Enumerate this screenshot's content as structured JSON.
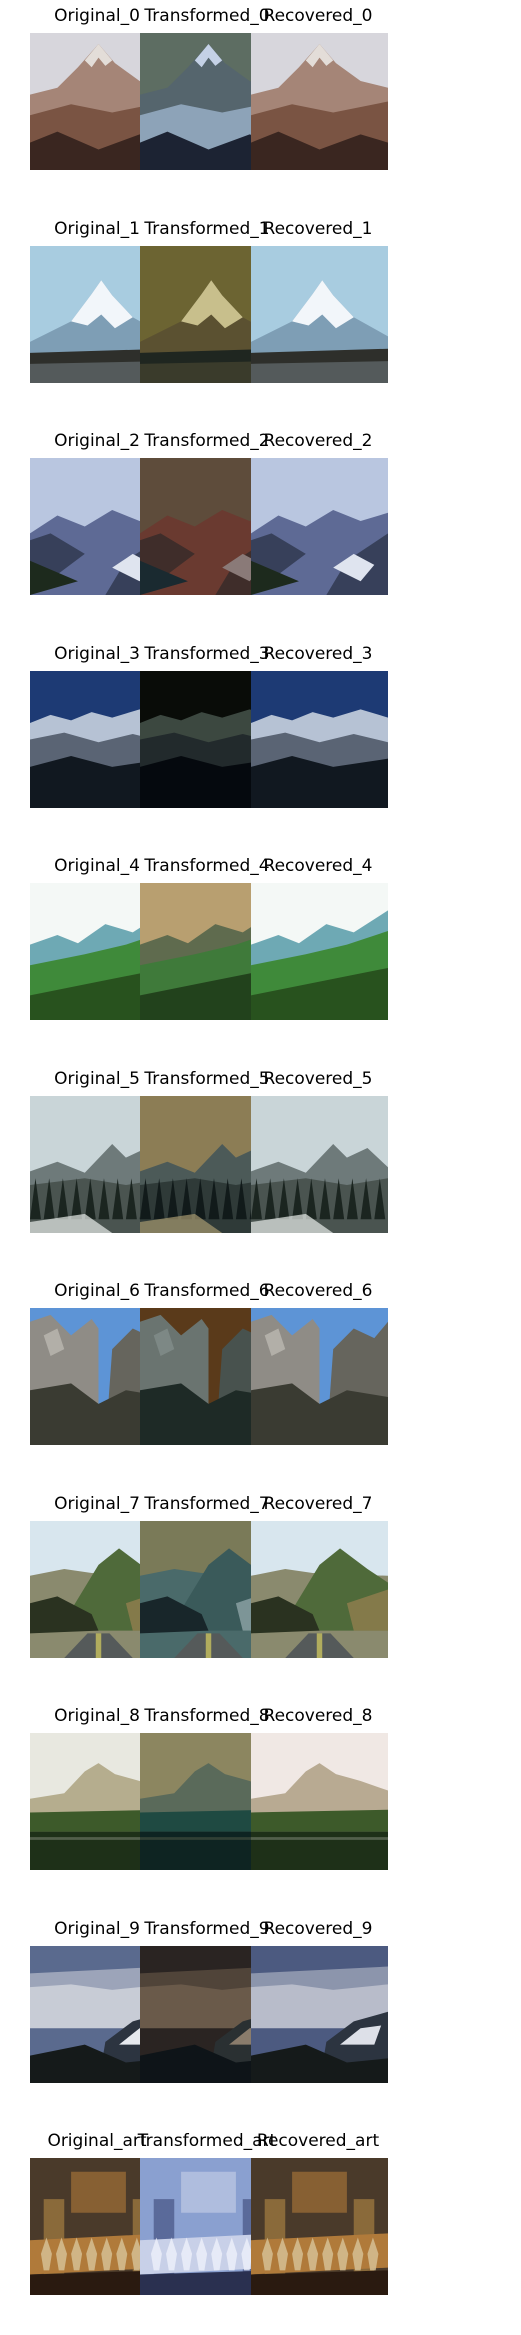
{
  "rows": [
    {
      "captions": [
        "Original_0",
        "Transformed_0",
        "Recovered_0"
      ],
      "scene": "peak",
      "palettes": [
        {
          "sky": "#d7d6dc",
          "far": "#a58577",
          "mid": "#7a5443",
          "near": "#3a2620",
          "snow": "#e3ddd8"
        },
        {
          "sky": "#5d6d62",
          "far": "#55656d",
          "mid": "#8da3b8",
          "near": "#1c2333",
          "snow": "#c4d1e6"
        },
        {
          "sky": "#d7d6dc",
          "far": "#a58577",
          "mid": "#7a5443",
          "near": "#3a2620",
          "snow": "#e3ddd8"
        }
      ]
    },
    {
      "captions": [
        "Original_1",
        "Transformed_1",
        "Recovered_1"
      ],
      "scene": "snowpeak",
      "palettes": [
        {
          "sky": "#a8cce0",
          "far": "#c9dceb",
          "mid": "#7e9eb5",
          "near": "#2e2f2b",
          "snow": "#f2f6fa"
        },
        {
          "sky": "#6c6432",
          "far": "#8a7c4a",
          "mid": "#5b5131",
          "near": "#1f2620",
          "snow": "#c8bf8c"
        },
        {
          "sky": "#a8cce0",
          "far": "#c9dceb",
          "mid": "#7e9eb5",
          "near": "#2e2f2b",
          "snow": "#f2f6fa"
        }
      ]
    },
    {
      "captions": [
        "Original_2",
        "Transformed_2",
        "Recovered_2"
      ],
      "scene": "valley",
      "palettes": [
        {
          "sky": "#b9c6e0",
          "far": "#5e6a95",
          "mid": "#37405a",
          "near": "#1d2a1d",
          "snow": "#dfe4ef"
        },
        {
          "sky": "#5e4c3b",
          "far": "#6a3a30",
          "mid": "#3f2d2a",
          "near": "#1a2a30",
          "snow": "#8a7a78"
        },
        {
          "sky": "#b9c6e0",
          "far": "#5e6a95",
          "mid": "#37405a",
          "near": "#1d2a1d",
          "snow": "#dfe4ef"
        }
      ]
    },
    {
      "captions": [
        "Original_3",
        "Transformed_3",
        "Recovered_3"
      ],
      "scene": "range",
      "palettes": [
        {
          "sky": "#1d3a74",
          "far": "#b6c2d4",
          "mid": "#5a6474",
          "near": "#111820",
          "snow": "#dde5ef"
        },
        {
          "sky": "#090c08",
          "far": "#3c4840",
          "mid": "#222a2c",
          "near": "#05090e",
          "snow": "#5a6a6a"
        },
        {
          "sky": "#1d3a74",
          "far": "#b6c2d4",
          "mid": "#5a6474",
          "near": "#111820",
          "snow": "#dde5ef"
        }
      ]
    },
    {
      "captions": [
        "Original_4",
        "Transformed_4",
        "Recovered_4"
      ],
      "scene": "meadow",
      "palettes": [
        {
          "sky": "#f4f8f6",
          "far": "#6ea9b4",
          "mid": "#3f8a3a",
          "near": "#28521e",
          "snow": "#ffffff"
        },
        {
          "sky": "#b89f70",
          "far": "#5f6b4e",
          "mid": "#3f7a3a",
          "near": "#22421c",
          "snow": "#c9b387"
        },
        {
          "sky": "#f4f8f6",
          "far": "#6ea9b4",
          "mid": "#3f8a3a",
          "near": "#28521e",
          "snow": "#ffffff"
        }
      ]
    },
    {
      "captions": [
        "Original_5",
        "Transformed_5",
        "Recovered_5"
      ],
      "scene": "forest",
      "palettes": [
        {
          "sky": "#c9d5d8",
          "far": "#6e7a7a",
          "mid": "#4a5450",
          "near": "#1b2520",
          "snow": "#e8ecea"
        },
        {
          "sky": "#8c7d55",
          "far": "#4c5a58",
          "mid": "#2f3a38",
          "near": "#111a1a",
          "snow": "#a79a70"
        },
        {
          "sky": "#c9d5d8",
          "far": "#6e7a7a",
          "mid": "#4a5450",
          "near": "#1b2520",
          "snow": "#e8ecea"
        }
      ]
    },
    {
      "captions": [
        "Original_6",
        "Transformed_6",
        "Recovered_6"
      ],
      "scene": "cliff",
      "palettes": [
        {
          "sky": "#5d94d6",
          "far": "#8f8c86",
          "mid": "#66655d",
          "near": "#3a3b32",
          "snow": "#c9c6bf"
        },
        {
          "sky": "#5a3a1a",
          "far": "#6a7470",
          "mid": "#48524e",
          "near": "#1e2a26",
          "snow": "#8a9692"
        },
        {
          "sky": "#5d94d6",
          "far": "#8f8c86",
          "mid": "#66655d",
          "near": "#3a3b32",
          "snow": "#c9c6bf"
        }
      ]
    },
    {
      "captions": [
        "Original_7",
        "Transformed_7",
        "Recovered_7"
      ],
      "scene": "road",
      "palettes": [
        {
          "sky": "#d8e6ee",
          "far": "#8a8a6e",
          "mid": "#4f6a3a",
          "near": "#2a3220",
          "snow": "#b98a5a"
        },
        {
          "sky": "#7a7a58",
          "far": "#4a6a6a",
          "mid": "#3a5a5a",
          "near": "#18262a",
          "snow": "#c0cfd4"
        },
        {
          "sky": "#d8e6ee",
          "far": "#8a8a6e",
          "mid": "#4f6a3a",
          "near": "#2a3220",
          "snow": "#b98a5a"
        }
      ]
    },
    {
      "captions": [
        "Original_8",
        "Transformed_8",
        "Recovered_8"
      ],
      "scene": "lake",
      "palettes": [
        {
          "sky": "#e8e8e0",
          "far": "#b5ad8e",
          "mid": "#3d5a2a",
          "near": "#1e3018",
          "snow": "#f0ede2"
        },
        {
          "sky": "#8c8660",
          "far": "#5a6a5a",
          "mid": "#1f4a42",
          "near": "#0e2422",
          "snow": "#9b9470"
        },
        {
          "sky": "#f0e8e4",
          "far": "#b8aa92",
          "mid": "#3d5a2a",
          "near": "#1e3018",
          "snow": "#f4eee6"
        }
      ]
    },
    {
      "captions": [
        "Original_9",
        "Transformed_9",
        "Recovered_9"
      ],
      "scene": "clouds",
      "palettes": [
        {
          "sky": "#5a6a8e",
          "far": "#c8ccd6",
          "mid": "#2c3440",
          "near": "#151a1a",
          "snow": "#e6e9ee"
        },
        {
          "sky": "#2a2422",
          "far": "#6a5a4a",
          "mid": "#2a3032",
          "near": "#0e1418",
          "snow": "#8a7c6c"
        },
        {
          "sky": "#4c5a80",
          "far": "#b8bcca",
          "mid": "#2c3440",
          "near": "#151a1a",
          "snow": "#dde0e8"
        }
      ]
    },
    {
      "captions": [
        "Original_art",
        "Transformed_art",
        "Recovered_art"
      ],
      "scene": "painting",
      "palettes": [
        {
          "sky": "#4a3a2a",
          "far": "#8a6a3a",
          "mid": "#b07a3a",
          "near": "#2a1a10",
          "snow": "#d8c49a"
        },
        {
          "sky": "#8aa0d0",
          "far": "#5a6a9a",
          "mid": "#c8d0e8",
          "near": "#2a3050",
          "snow": "#eef0fa"
        },
        {
          "sky": "#4a3a2a",
          "far": "#8a6a3a",
          "mid": "#b07a3a",
          "near": "#2a1a10",
          "snow": "#d8c49a"
        }
      ]
    }
  ]
}
